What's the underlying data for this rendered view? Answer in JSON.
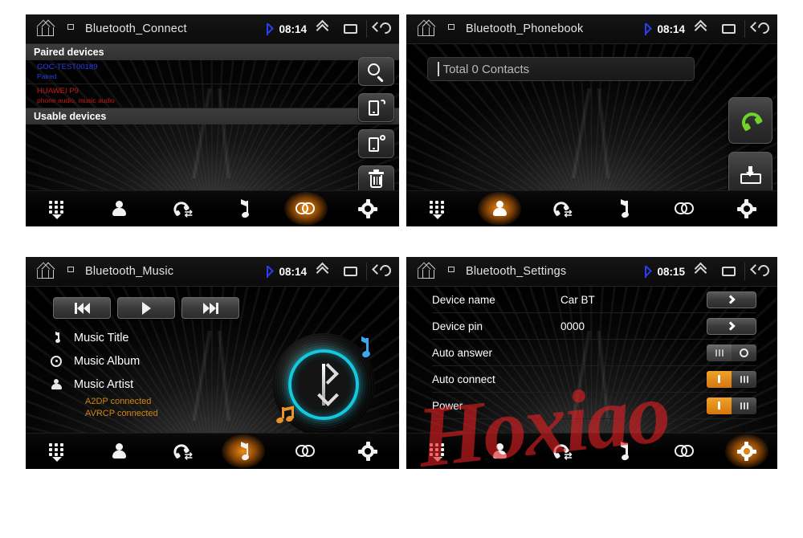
{
  "watermark": "Hoxiao",
  "statusbar": {
    "clock_connect": "08:14",
    "clock_phonebook": "08:14",
    "clock_music": "08:14",
    "clock_settings": "08:15"
  },
  "panels": {
    "connect": {
      "title": "Bluetooth_Connect",
      "paired_header": "Paired devices",
      "usable_header": "Usable devices",
      "devices": [
        {
          "name": "GOC-TEST00189",
          "status": "Paired",
          "color": "#2b3ef0"
        },
        {
          "name": "HUAWEI P9",
          "status": "phone audio, music audio",
          "color": "#c41a1a"
        }
      ],
      "buttons": [
        {
          "name": "search-button",
          "icon": "search-icon"
        },
        {
          "name": "pair-device-button",
          "icon": "phone-signal-icon"
        },
        {
          "name": "disconnect-device-button",
          "icon": "phone-dot-icon"
        },
        {
          "name": "delete-device-button",
          "icon": "trash-icon"
        }
      ]
    },
    "phonebook": {
      "title": "Bluetooth_Phonebook",
      "search_value": "Total 0 Contacts",
      "search_placeholder": "Total 0 Contacts",
      "buttons": [
        {
          "name": "dial-call-button",
          "icon": "green-phone-icon"
        },
        {
          "name": "download-contacts-button",
          "icon": "download-icon"
        }
      ]
    },
    "music": {
      "title": "Bluetooth_Music",
      "controls": [
        {
          "name": "previous-track-button",
          "icon": "skip-back-icon"
        },
        {
          "name": "play-button",
          "icon": "play-icon"
        },
        {
          "name": "next-track-button",
          "icon": "skip-forward-icon"
        }
      ],
      "info": [
        {
          "label": "Music Title",
          "icon": "music-note-icon"
        },
        {
          "label": "Music Album",
          "icon": "disc-icon"
        },
        {
          "label": "Music Artist",
          "icon": "person-icon"
        }
      ],
      "status": [
        "A2DP connected",
        "AVRCP connected"
      ],
      "status_color": "#d0860f"
    },
    "settings": {
      "title": "Bluetooth_Settings",
      "rows": [
        {
          "label": "Device name",
          "value": "Car BT",
          "control": "arrow"
        },
        {
          "label": "Device pin",
          "value": "0000",
          "control": "arrow"
        },
        {
          "label": "Auto answer",
          "value": "",
          "control": "toggle",
          "state": "off"
        },
        {
          "label": "Auto connect",
          "value": "",
          "control": "toggle",
          "state": "on"
        },
        {
          "label": "Power",
          "value": "",
          "control": "toggle",
          "state": "on"
        }
      ]
    }
  },
  "nav": {
    "items": [
      {
        "label": "Dial",
        "icon": "dialpad-icon"
      },
      {
        "label": "Contacts",
        "icon": "person-icon"
      },
      {
        "label": "Calls",
        "icon": "phone-icon"
      },
      {
        "label": "Music",
        "icon": "music-note-icon"
      },
      {
        "label": "Connect",
        "icon": "link-icon"
      },
      {
        "label": "Settings",
        "icon": "gear-icon"
      }
    ],
    "active_connect": "Connect",
    "active_phonebook": "Contacts",
    "active_music": "Music",
    "active_settings": "Settings"
  },
  "colors": {
    "accent": "#f0a32a",
    "bluetooth_blue": "#2b3ef0",
    "ring_cyan": "#16c8de",
    "call_green": "#6fd32a",
    "watermark_red": "#df1e24"
  }
}
